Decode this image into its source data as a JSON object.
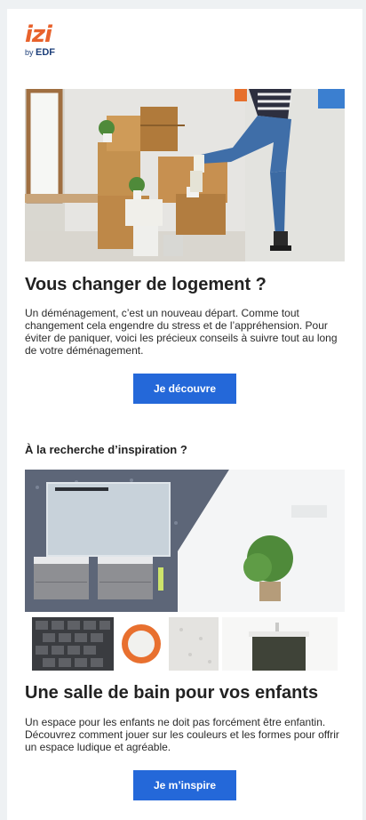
{
  "brand": {
    "name": "izi",
    "by": "by",
    "company": "EDF",
    "primary": "#e8622c",
    "secondary": "#1d3f7a"
  },
  "section1": {
    "image": "moving-couple-photo",
    "title": "Vous changer de logement ?",
    "body": "Un déménagement, c’est un nouveau départ. Comme tout changement cela engendre du stress et de l’appréhension. Pour éviter de paniquer, voici les précieux conseils à suivre tout au long de votre déménagement.",
    "cta": "Je découvre"
  },
  "section2": {
    "kicker": "À la recherche d’inspiration ?",
    "image": "bathroom-moodboard-photo",
    "title": "Une salle de bain pour vos enfants",
    "body": "Un espace pour les enfants ne doit pas forcément être enfantin. Découvrez comment jouer sur les couleurs et les formes pour offrir un espace ludique et agréable.",
    "cta": "Je m’inspire"
  },
  "colors": {
    "button": "#2468d9",
    "background": "#eef1f3"
  }
}
